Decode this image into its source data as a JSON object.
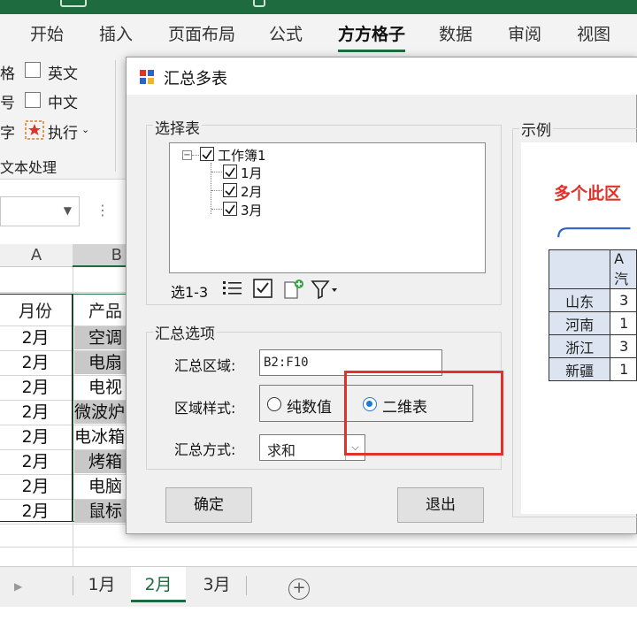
{
  "ribbon": {
    "tabs": [
      "开始",
      "插入",
      "页面布局",
      "公式",
      "方方格子",
      "数据",
      "审阅",
      "视图"
    ],
    "active_tab": "方方格子",
    "row1_left": "格",
    "row2_left": "号",
    "row3_left": "字",
    "english_label": "英文",
    "chinese_label": "中文",
    "execute_label": "执行",
    "group_label": "文本处理"
  },
  "sheet": {
    "column_a": "A",
    "column_b": "B",
    "header_month": "月份",
    "header_product": "产品",
    "rows": [
      {
        "month": "2月",
        "product": "空调"
      },
      {
        "month": "2月",
        "product": "电扇"
      },
      {
        "month": "2月",
        "product": "电视"
      },
      {
        "month": "2月",
        "product": "微波炉"
      },
      {
        "month": "2月",
        "product": "电冰箱"
      },
      {
        "month": "2月",
        "product": "烤箱"
      },
      {
        "month": "2月",
        "product": "电脑"
      },
      {
        "month": "2月",
        "product": "鼠标"
      }
    ],
    "tabs": [
      "1月",
      "2月",
      "3月"
    ],
    "active_tab": "2月"
  },
  "dialog": {
    "title": "汇总多表",
    "select_group": "选择表",
    "workbook": "工作簿1",
    "sheets": [
      "1月",
      "2月",
      "3月"
    ],
    "selection_label": "选1-3",
    "options_group": "汇总选项",
    "range_label": "汇总区域:",
    "range_value": "B2:F10",
    "style_label": "区域样式:",
    "style_option_1": "纯数值",
    "style_option_2": "二维表",
    "style_selected": "二维表",
    "method_label": "汇总方式:",
    "method_value": "求和",
    "ok_button": "确定",
    "exit_button": "退出",
    "example_group": "示例",
    "example_title": "多个此区",
    "example_col_header": "A汽",
    "example_rows": [
      {
        "label": "山东",
        "value": "3"
      },
      {
        "label": "河南",
        "value": "1"
      },
      {
        "label": "浙江",
        "value": "3"
      },
      {
        "label": "新疆",
        "value": "1"
      }
    ]
  },
  "colors": {
    "brand_green": "#1e6b3f",
    "highlight_red": "#e0322a",
    "radio_blue": "#1e78d7"
  }
}
